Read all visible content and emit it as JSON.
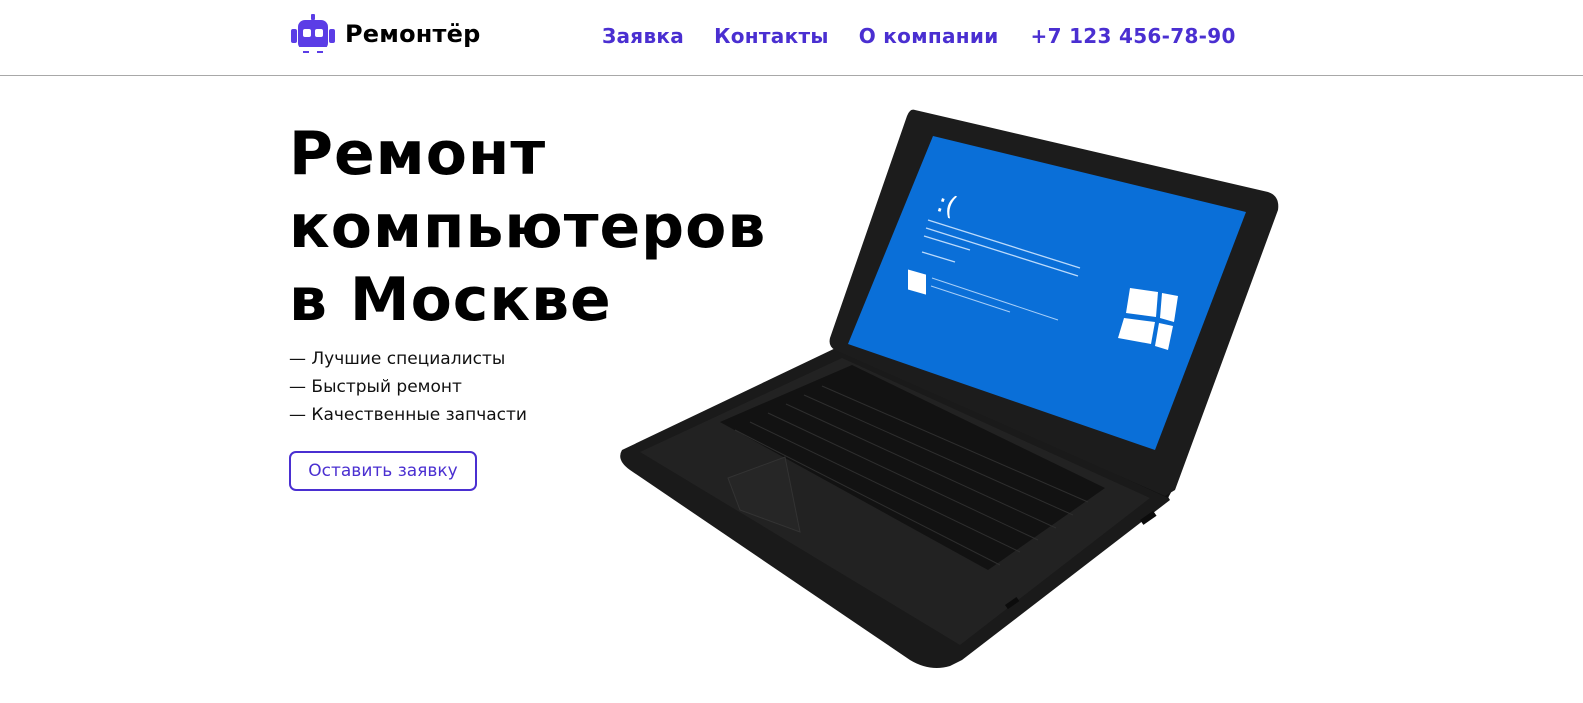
{
  "header": {
    "logo_text": "Ремонтёр",
    "logo_icon": "robot-icon",
    "nav": {
      "request": "Заявка",
      "contacts": "Контакты",
      "about": "О компании",
      "phone": "+7 123 456-78-90"
    }
  },
  "hero": {
    "title_lines": [
      "Ремонт",
      "компьютеров",
      "в Москве"
    ],
    "features": [
      "— Лучшие специалисты",
      "— Быстрый ремонт",
      "— Качественные запчасти"
    ],
    "cta_label": "Оставить заявку",
    "image": "laptop-bsod-image"
  },
  "colors": {
    "accent": "#4a2fd1",
    "screen_blue": "#0a6fd8",
    "laptop_body": "#1c1c1c"
  }
}
